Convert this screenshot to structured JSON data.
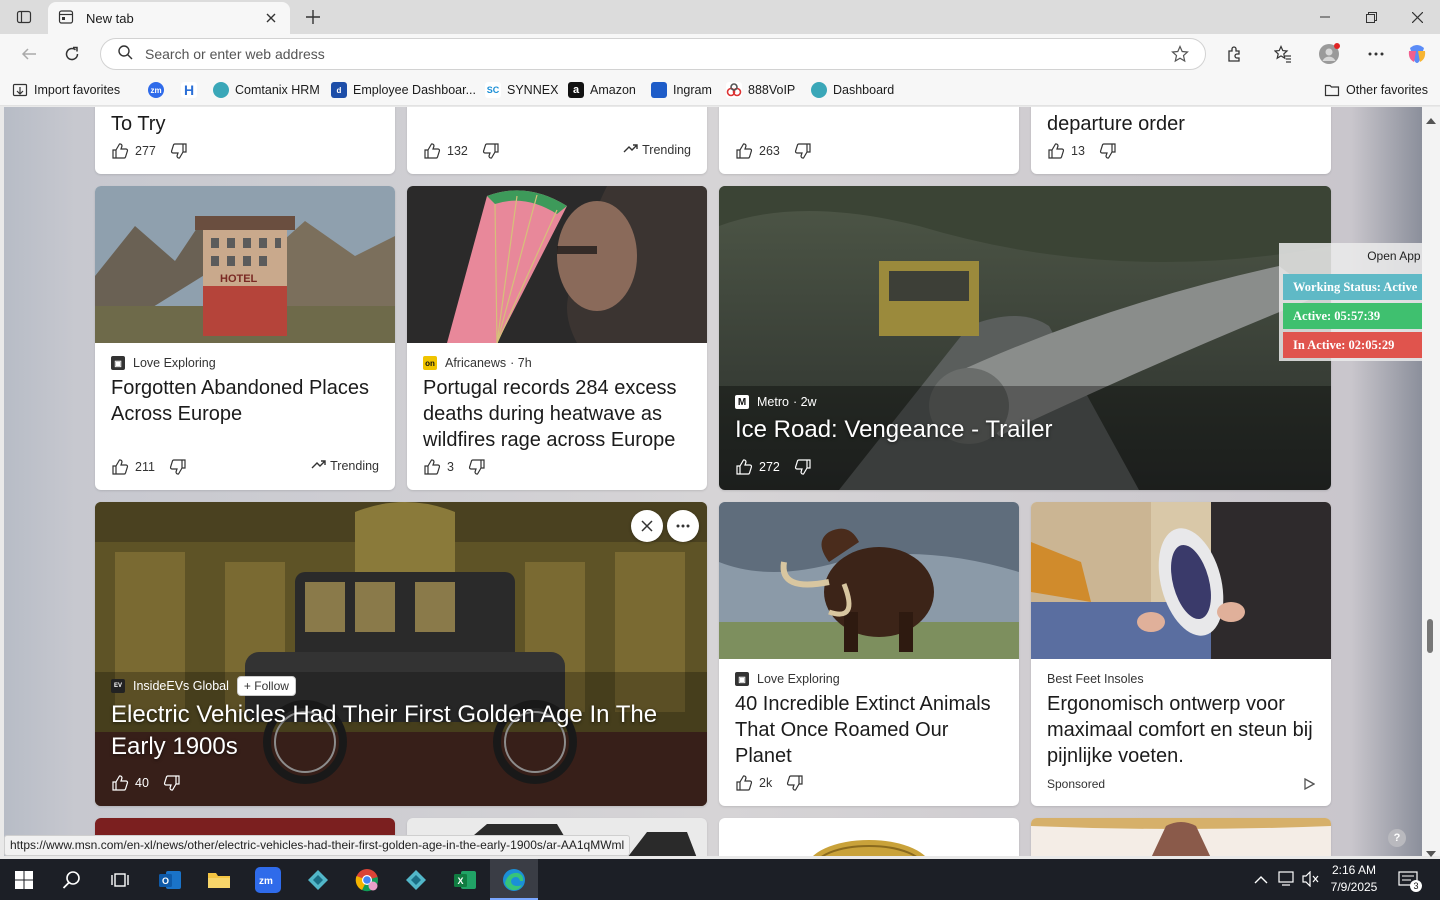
{
  "browser": {
    "tab_title": "New tab",
    "address_placeholder": "Search or enter web address"
  },
  "bookmarks": [
    {
      "label": "Import favorites",
      "icon": "import-icon"
    },
    {
      "label": "",
      "icon": "zoom-icon"
    },
    {
      "label": "",
      "icon": "h-app-icon"
    },
    {
      "label": "Comtanix HRM",
      "icon": "comtanix-icon"
    },
    {
      "label": "Employee Dashboar...",
      "icon": "employee-icon"
    },
    {
      "label": "SYNNEX",
      "icon": "synnex-icon"
    },
    {
      "label": "Amazon",
      "icon": "amazon-icon"
    },
    {
      "label": "Ingram",
      "icon": "ingram-icon"
    },
    {
      "label": "888VoIP",
      "icon": "voip-icon"
    },
    {
      "label": "Dashboard",
      "icon": "dashboard-icon"
    }
  ],
  "other_favorites": "Other favorites",
  "top_row": [
    {
      "headline": "To Try",
      "likes": "277",
      "trending": ""
    },
    {
      "headline": "",
      "likes": "132",
      "trending": "Trending"
    },
    {
      "headline": "",
      "likes": "263",
      "trending": ""
    },
    {
      "headline": "departure order",
      "likes": "13",
      "trending": ""
    }
  ],
  "cards": {
    "abandoned": {
      "source": "Love Exploring",
      "headline": "Forgotten Abandoned Places Across Europe",
      "likes": "211",
      "trending": "Trending"
    },
    "portugal": {
      "source": "Africanews",
      "time": "· 7h",
      "headline": "Portugal records 284 excess deaths during heatwave as wildfires rage across Europe",
      "likes": "3"
    },
    "iceroad": {
      "source": "Metro",
      "time": "· 2w",
      "headline": "Ice Road: Vengeance - Trailer",
      "likes": "272"
    },
    "ev": {
      "source": "InsideEVs Global",
      "follow": "+ Follow",
      "headline": "Electric Vehicles Had Their First Golden Age In The Early 1900s",
      "likes": "40"
    },
    "mammoth": {
      "source": "Love Exploring",
      "headline": "40 Incredible Extinct Animals That Once Roamed Our Planet",
      "likes": "2k"
    },
    "insoles": {
      "source": "Best Feet Insoles",
      "headline": "Ergonomisch ontwerp voor maximaal comfort en steun bij pijnlijke voeten.",
      "sponsored": "Sponsored"
    }
  },
  "widget": {
    "open_app": "Open App ↗",
    "status": "Working Status: Active",
    "active": "Active: 05:57:39",
    "inactive": "In Active: 02:05:29",
    "colors": {
      "status": "#5fb9c6",
      "active": "#3fc06f",
      "inactive": "#e0544d"
    }
  },
  "status_url": "https://www.msn.com/en-xl/news/other/electric-vehicles-had-their-first-golden-age-in-the-early-1900s/ar-AA1qMWml",
  "taskbar": {
    "time": "2:16 AM",
    "date": "7/9/2025",
    "notification_count": "3"
  }
}
